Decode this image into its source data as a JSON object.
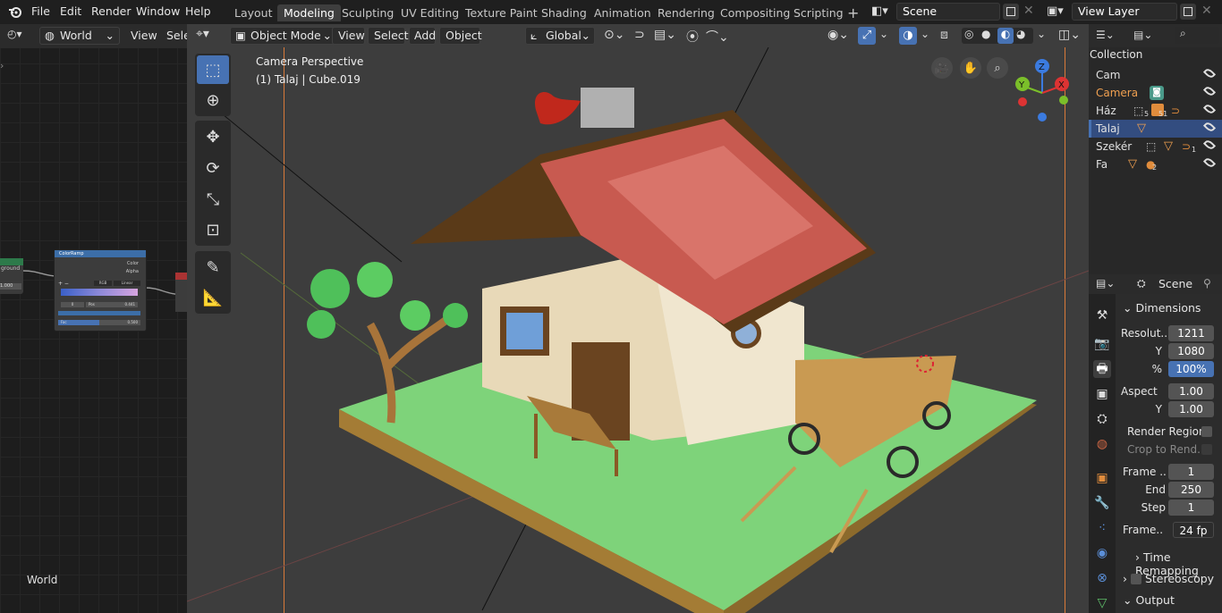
{
  "topbar": {
    "menu": [
      "File",
      "Edit",
      "Render",
      "Window",
      "Help"
    ],
    "workspaces": [
      "Layout",
      "Modeling",
      "Sculpting",
      "UV Editing",
      "Texture Paint",
      "Shading",
      "Animation",
      "Rendering",
      "Compositing",
      "Scripting"
    ],
    "active_workspace": "Modeling",
    "add_tab": "+",
    "scene": "Scene",
    "view_layer": "View Layer"
  },
  "node_editor": {
    "world_dropdown": "World",
    "view": "View",
    "select": "Sele",
    "footer_label": "World",
    "node_colorramp": {
      "title": "ColorRamp",
      "out_color": "Color",
      "out_alpha": "Alpha",
      "mode": "RGB",
      "interp": "Linear",
      "index": "0",
      "pos_label": "Pos",
      "pos_value": "0.441",
      "fac_label": "Fac",
      "fac_value": "0.500"
    },
    "node_left": {
      "label": "ground",
      "value": "1.000"
    }
  },
  "viewport": {
    "mode": "Object Mode",
    "view": "View",
    "select": "Select",
    "add": "Add",
    "object": "Object",
    "orientation": "Global",
    "overlay_title": "Camera Perspective",
    "overlay_subtitle": "(1) Talaj | Cube.019",
    "gizmo_axes": {
      "x": "X",
      "y": "Y",
      "z": "Z"
    }
  },
  "outliner": {
    "header": "Collection",
    "rows": [
      {
        "name": "Cam",
        "color": "#e6e6e6",
        "selected": false
      },
      {
        "name": "Camera",
        "color": "#f0a050",
        "selected": false
      },
      {
        "name": "Ház",
        "color": "#e6e6e6",
        "selected": false,
        "badge": "5",
        "badge2": "51"
      },
      {
        "name": "Talaj",
        "color": "#e6e6e6",
        "selected": true
      },
      {
        "name": "Szekér",
        "color": "#e6e6e6",
        "selected": false,
        "badge": "1"
      },
      {
        "name": "Fa",
        "color": "#e6e6e6",
        "selected": false,
        "badge": "2"
      }
    ]
  },
  "properties": {
    "context": "Scene",
    "dimensions": "Dimensions",
    "resolution_x_label": "Resolut..",
    "resolution_x": "1211",
    "resolution_y_label": "Y",
    "resolution_y": "1080",
    "percent_label": "%",
    "percent": "100%",
    "aspect_label": "Aspect",
    "aspect_x": "1.00",
    "aspect_y_label": "Y",
    "aspect_y": "1.00",
    "render_region": "Render Region",
    "crop": "Crop to Rend..",
    "frame_start_label": "Frame ..",
    "frame_start": "1",
    "end_label": "End",
    "end": "250",
    "step_label": "Step",
    "step": "1",
    "fps_label": "Frame..",
    "fps": "24 fp",
    "time_remapping": "Time Remapping",
    "stereoscopy": "Stereoscopy",
    "output": "Output"
  },
  "colors": {
    "accent": "#4772b3",
    "camera_orange": "#f0a050",
    "ground_green": "#7ed37a"
  }
}
